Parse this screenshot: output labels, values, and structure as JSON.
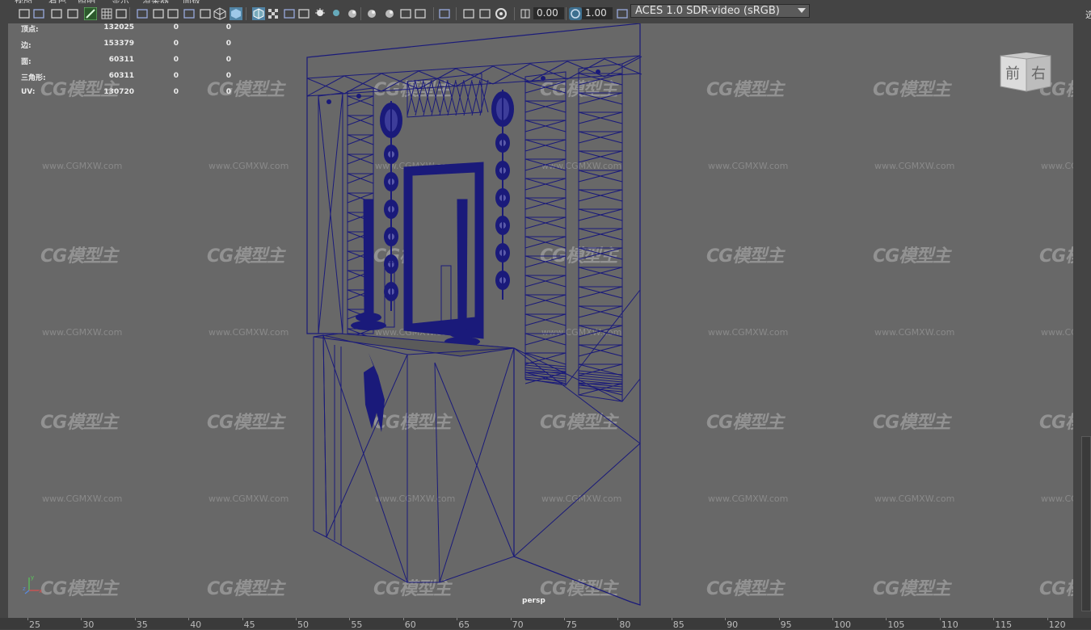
{
  "menu": {
    "items": [
      "视图",
      "着色",
      "照明",
      "显示",
      "渲染器",
      "面板"
    ]
  },
  "toolbar": {
    "exposure_value": "0.00",
    "gamma_value": "1.00",
    "color_management": "ACES 1.0 SDR-video (sRGB)",
    "icons": [
      "select-camera-icon",
      "camera-attributes-icon",
      "bookmark-icon",
      "image-plane-icon",
      "grease-pencil-icon",
      "grid-icon",
      "film-gate-icon",
      "resolution-gate-icon",
      "gate-mask-icon",
      "field-chart-icon",
      "safe-action-icon",
      "safe-title-icon",
      "wireframe-icon",
      "smooth-shade-icon",
      "wireframe-on-shaded-icon",
      "xray-icon",
      "use-default-material-icon",
      "textured-icon",
      "lights-icon",
      "shadows-icon",
      "screen-space-ao-icon",
      "motion-blur-icon",
      "multisample-aa-icon",
      "depth-of-field-icon",
      "isolate-select-icon",
      "xray-joints-icon",
      "xray-active-icon",
      "backface-culling-icon",
      "exposure-icon",
      "gamma-icon",
      "color-management-icon"
    ]
  },
  "stats": {
    "rows": [
      {
        "label": "顶点:",
        "v1": "132025",
        "v2": "0",
        "v3": "0"
      },
      {
        "label": "边:",
        "v1": "153379",
        "v2": "0",
        "v3": "0"
      },
      {
        "label": "面:",
        "v1": "60311",
        "v2": "0",
        "v3": "0"
      },
      {
        "label": "三角形:",
        "v1": "60311",
        "v2": "0",
        "v3": "0"
      },
      {
        "label": "UV:",
        "v1": "130720",
        "v2": "0",
        "v3": "0"
      }
    ]
  },
  "viewcube": {
    "front": "前",
    "right": "右"
  },
  "camera_label": "persp",
  "axis": {
    "y": "y",
    "z": "z",
    "x": "x"
  },
  "watermark": {
    "logo": "CG模型主",
    "url": "www.CGMXW.com"
  },
  "timeline": {
    "ticks": [
      "25",
      "30",
      "35",
      "40",
      "45",
      "50",
      "55",
      "60",
      "65",
      "70",
      "75",
      "80",
      "85",
      "90",
      "95",
      "100",
      "105",
      "110",
      "115",
      "120"
    ]
  },
  "right_panel": {
    "chars": [
      "选",
      "建",
      "属"
    ]
  },
  "colors": {
    "viewport": "#686868",
    "wireframe": "#1a1a7a",
    "ui_bg": "#444444",
    "accent": "#5285a6"
  }
}
